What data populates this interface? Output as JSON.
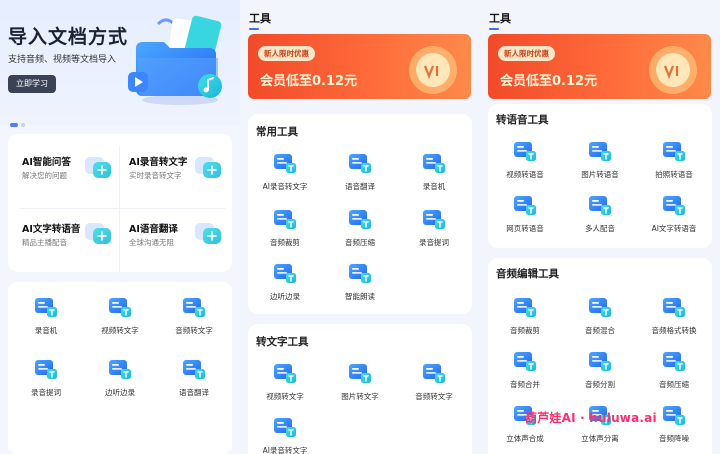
{
  "hero": {
    "title": "导入文档方式",
    "subtitle": "支持音频、视频等文档导入",
    "button": "立即学习"
  },
  "features": [
    {
      "title": "AI智能问答",
      "sub": "解决您的问题",
      "icon": "chat-icon"
    },
    {
      "title": "AI录音转文字",
      "sub": "实时录音转文字",
      "icon": "record-text-icon"
    },
    {
      "title": "AI文字转语音",
      "sub": "精品主播配音",
      "icon": "text-to-speech-icon"
    },
    {
      "title": "AI语音翻译",
      "sub": "全球沟通无阻",
      "icon": "voice-translate-icon"
    }
  ],
  "quick_tools": [
    "录音机",
    "视频转文字",
    "音频转文字",
    "录音提词",
    "边听边录",
    "语音翻译"
  ],
  "tools_heading": "工具",
  "banner": {
    "tag": "新人限时优惠",
    "text": "会员低至0.12元"
  },
  "common": {
    "title": "常用工具",
    "items": [
      "AI录音转文字",
      "语音翻译",
      "录音机",
      "音频裁剪",
      "音频压缩",
      "录音提词",
      "边听边录",
      "智能朗读"
    ]
  },
  "to_text": {
    "title": "转文字工具",
    "items": [
      "视频转文字",
      "图片转文字",
      "音频转文字",
      "AI录音转文字"
    ]
  },
  "to_speech": {
    "title": "转语音工具",
    "items": [
      "视频转语音",
      "图片转语音",
      "拍照转语音",
      "网页转语音",
      "多人配音",
      "AI文字转语音"
    ]
  },
  "audio_edit": {
    "title": "音频编辑工具",
    "items": [
      "音频裁剪",
      "音频混合",
      "音频格式转换",
      "音频合并",
      "音频分割",
      "音频压缩",
      "立体声合成",
      "立体声分离",
      "音频降噪"
    ]
  },
  "watermark": "葫芦娃AI · huluwa.ai",
  "colors": {
    "accent": "#3d6ff5",
    "icon_blue": "#2f7bff",
    "banner": "#f24a2a",
    "watermark": "#ff2f6e"
  }
}
